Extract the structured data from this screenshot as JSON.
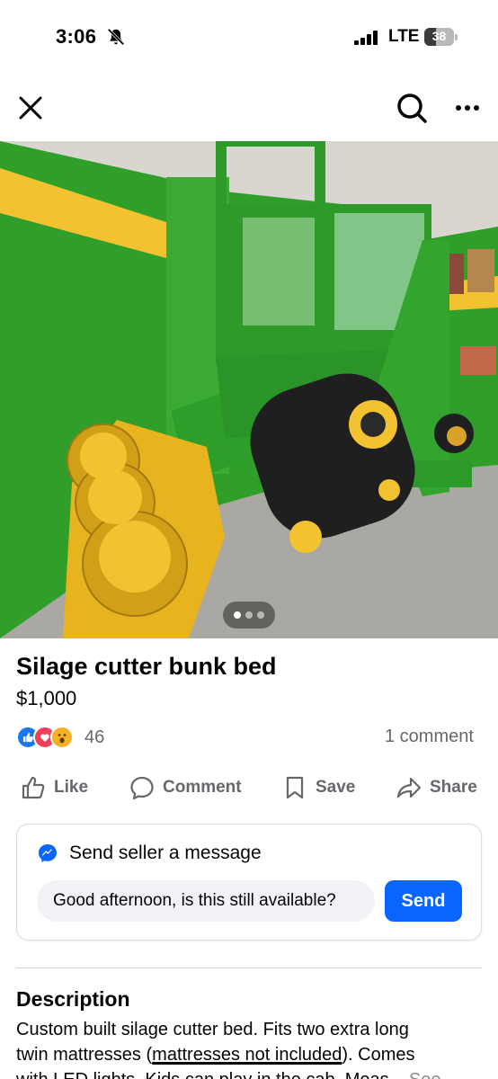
{
  "status_bar": {
    "time": "3:06",
    "network": "LTE",
    "battery": "38",
    "battery_level": 0.38
  },
  "nav": {
    "close_icon": "close-icon",
    "search_icon": "search-icon",
    "more_icon": "more-icon"
  },
  "photo": {
    "carousel_total": 3,
    "carousel_active_index": 0
  },
  "listing": {
    "title": "Silage cutter bunk bed",
    "price": "$1,000",
    "reaction_count": "46",
    "comments": "1 comment"
  },
  "actions": [
    {
      "label": "Like",
      "icon": "like-icon"
    },
    {
      "label": "Comment",
      "icon": "comment-icon"
    },
    {
      "label": "Save",
      "icon": "save-icon"
    },
    {
      "label": "Share",
      "icon": "share-icon"
    }
  ],
  "message": {
    "title": "Send seller a message",
    "value": "Good afternoon, is this still available?",
    "send_label": "Send"
  },
  "description": {
    "heading": "Description",
    "line1": "Custom built silage cutter bed. Fits two extra long",
    "line2a": "twin mattresses (",
    "line2b": "mattresses not included",
    "line2c": "). Comes",
    "line3": "with LED lights. Kids can play in the cab. Meas...",
    "see_more": "See"
  },
  "colors": {
    "accent": "#0866ff",
    "muted_text": "#65676b",
    "wall_green": "#2f9f2a",
    "stripe_yellow": "#f2c230"
  }
}
